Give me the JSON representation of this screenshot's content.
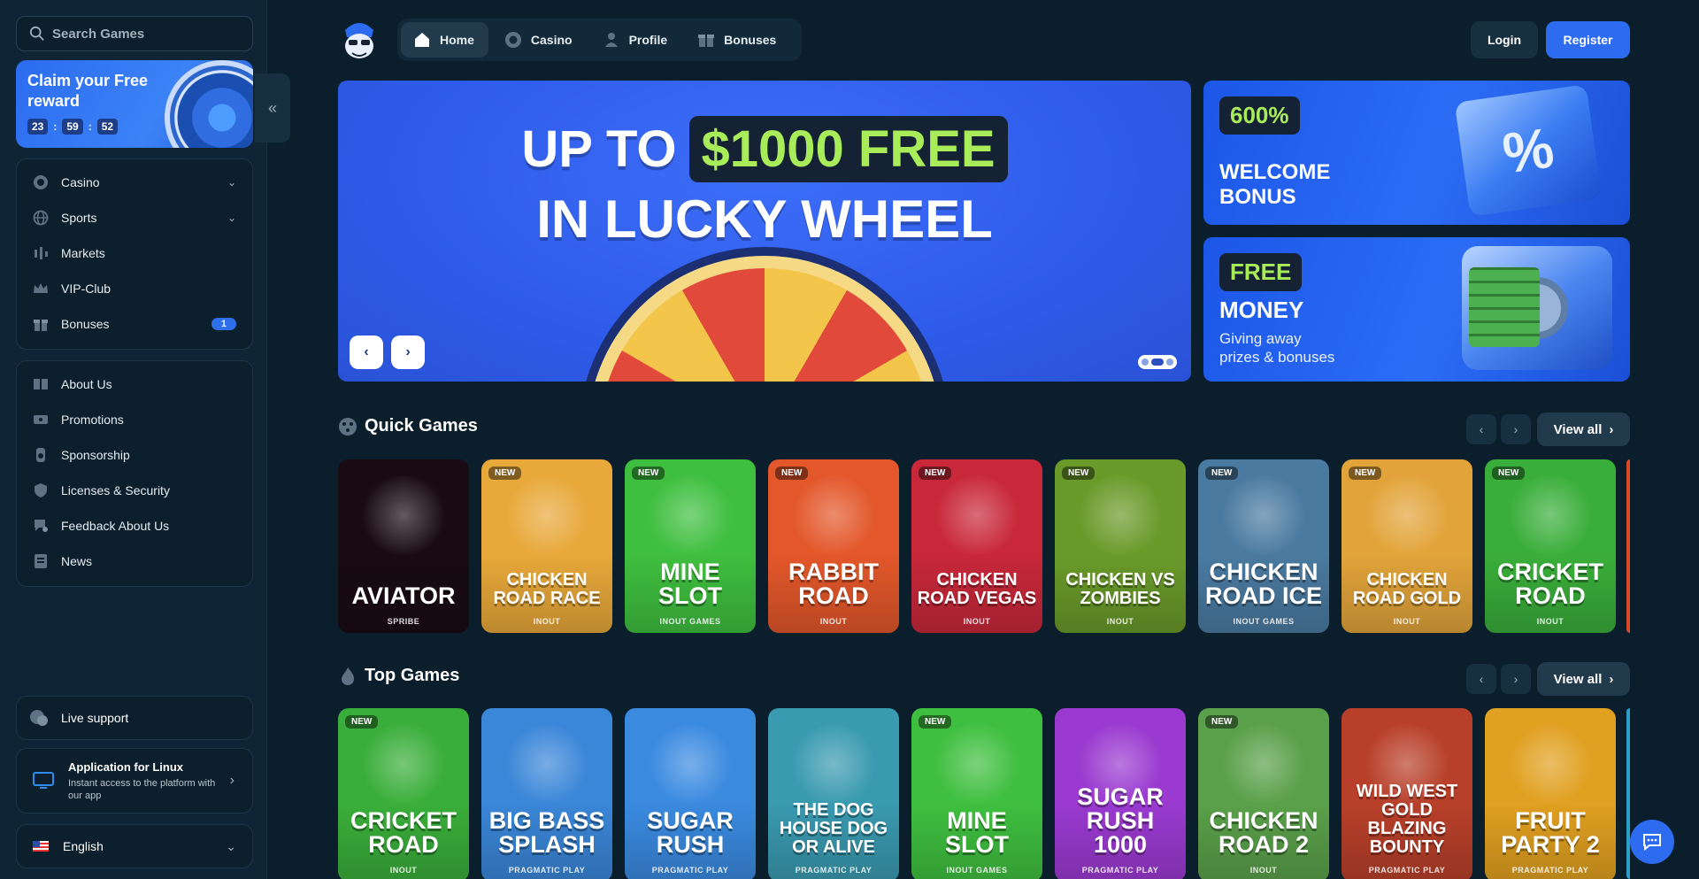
{
  "search": {
    "placeholder": "Search Games"
  },
  "reward": {
    "title": "Claim your Free reward",
    "hours": "23",
    "minutes": "59",
    "seconds": "52"
  },
  "sidebar": {
    "main_items": [
      {
        "label": "Casino",
        "icon": "casino-chip-icon",
        "expandable": true
      },
      {
        "label": "Sports",
        "icon": "globe-icon",
        "expandable": true
      },
      {
        "label": "Markets",
        "icon": "candlestick-icon"
      },
      {
        "label": "VIP-Club",
        "icon": "crown-icon"
      },
      {
        "label": "Bonuses",
        "icon": "gift-icon",
        "badge": "1"
      }
    ],
    "info_items": [
      {
        "label": "About Us",
        "icon": "book-icon"
      },
      {
        "label": "Promotions",
        "icon": "ticket-icon"
      },
      {
        "label": "Sponsorship",
        "icon": "medal-icon"
      },
      {
        "label": "Licenses & Security",
        "icon": "shield-icon"
      },
      {
        "label": "Feedback About Us",
        "icon": "feedback-icon"
      },
      {
        "label": "News",
        "icon": "newspaper-icon"
      }
    ],
    "live_support": "Live support",
    "app": {
      "title": "Application for Linux",
      "subtitle": "Instant access to the platform with our app"
    },
    "language": "English"
  },
  "header": {
    "tabs": [
      {
        "label": "Home",
        "icon": "home-icon",
        "active": true
      },
      {
        "label": "Casino",
        "icon": "casino-chip-icon"
      },
      {
        "label": "Profile",
        "icon": "user-icon"
      },
      {
        "label": "Bonuses",
        "icon": "gift-icon"
      }
    ],
    "login": "Login",
    "register": "Register"
  },
  "hero": {
    "line1_a": "UP TO",
    "line1_highlight": "$1000 FREE",
    "line2": "IN LUCKY WHEEL",
    "prev": "‹",
    "next": "›"
  },
  "promos": {
    "welcome": {
      "pill": "600%",
      "line1": "WELCOME",
      "line2": "BONUS"
    },
    "money": {
      "pill": "FREE",
      "title": "MONEY",
      "line1": "Giving away",
      "line2": "prizes & bonuses"
    }
  },
  "quick_games": {
    "title": "Quick Games",
    "view_all": "View all",
    "games": [
      {
        "title": "AVIATOR",
        "provider": "SPRIBE",
        "new": false,
        "bg": "#1a0b12"
      },
      {
        "title": "CHICKEN ROAD RACE",
        "provider": "INOUT",
        "new": true,
        "bg": "#e8a83a"
      },
      {
        "title": "MINE SLOT",
        "provider": "INOUT GAMES",
        "new": true,
        "bg": "#3fbf3f"
      },
      {
        "title": "RABBIT ROAD",
        "provider": "INOUT",
        "new": true,
        "bg": "#e3572a"
      },
      {
        "title": "CHICKEN ROAD VEGAS",
        "provider": "INOUT",
        "new": true,
        "bg": "#c8283a"
      },
      {
        "title": "CHICKEN VS ZOMBIES",
        "provider": "INOUT",
        "new": true,
        "bg": "#6a9a2a"
      },
      {
        "title": "CHICKEN ROAD ICE",
        "provider": "INOUT GAMES",
        "new": true,
        "bg": "#4a7aa0"
      },
      {
        "title": "CHICKEN ROAD GOLD",
        "provider": "INOUT",
        "new": true,
        "bg": "#e2a43a"
      },
      {
        "title": "CRICKET ROAD",
        "provider": "INOUT",
        "new": true,
        "bg": "#3aae3a"
      }
    ]
  },
  "top_games": {
    "title": "Top Games",
    "view_all": "View all",
    "games": [
      {
        "title": "CRICKET ROAD",
        "provider": "INOUT",
        "new": true,
        "bg": "#3aae3a"
      },
      {
        "title": "BIG BASS SPLASH",
        "provider": "PRAGMATIC PLAY",
        "new": false,
        "bg": "#3a86d8"
      },
      {
        "title": "SUGAR RUSH",
        "provider": "PRAGMATIC PLAY",
        "new": false,
        "bg": "#3a8ae0"
      },
      {
        "title": "THE DOG HOUSE DOG OR ALIVE",
        "provider": "PRAGMATIC PLAY",
        "new": false,
        "bg": "#3a9ab0"
      },
      {
        "title": "MINE SLOT",
        "provider": "INOUT GAMES",
        "new": true,
        "bg": "#3fbf3f"
      },
      {
        "title": "SUGAR RUSH 1000",
        "provider": "PRAGMATIC PLAY",
        "new": false,
        "bg": "#9a3ad0"
      },
      {
        "title": "CHICKEN ROAD 2",
        "provider": "INOUT",
        "new": true,
        "bg": "#5aa04a"
      },
      {
        "title": "WILD WEST GOLD BLAZING BOUNTY",
        "provider": "PRAGMATIC PLAY",
        "new": false,
        "bg": "#b8402a"
      },
      {
        "title": "FRUIT PARTY 2",
        "provider": "PRAGMATIC PLAY",
        "new": false,
        "bg": "#e0a020"
      }
    ]
  },
  "badge_new": "NEW",
  "colors": {
    "accent": "#2d6cf0",
    "bg": "#0a1e2b",
    "sidebar": "#0f2535",
    "highlight": "#a9ec5a"
  }
}
